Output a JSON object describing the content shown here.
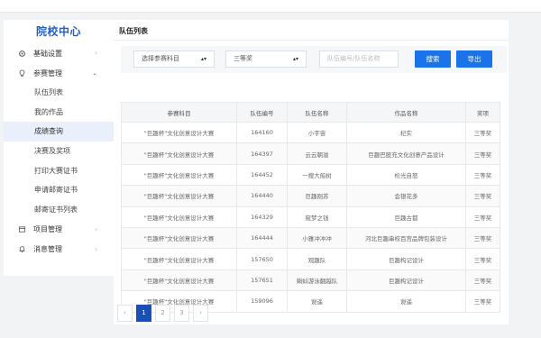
{
  "sidebar": {
    "brand": "院校中心",
    "menus": [
      {
        "label": "基础设置",
        "icon": "settings-icon"
      },
      {
        "label": "参赛管理",
        "icon": "lightbulb-icon"
      },
      {
        "label": "项目管理",
        "icon": "project-icon"
      },
      {
        "label": "消息管理",
        "icon": "bell-icon"
      }
    ],
    "sub_items": [
      "队伍列表",
      "我的作品",
      "成绩查询",
      "决赛及奖项",
      "打印大赛证书",
      "申请邮寄证书",
      "邮寄证书列表"
    ],
    "active_sub_item": "成绩查询"
  },
  "main": {
    "title": "队伍列表"
  },
  "filters": {
    "subject_select": "选择参赛科目",
    "award_select": "三等奖",
    "search_placeholder": "队伍编号/队伍名称",
    "search_button": "搜索",
    "export_button": "导出"
  },
  "table": {
    "headers": [
      "参赛科目",
      "队伍编号",
      "队伍名称",
      "作品名称",
      "奖项"
    ],
    "rows": [
      [
        "\"巨趣杯\"文化创意设计大赛",
        "164160",
        "小宇宙",
        "杞实",
        "三等奖"
      ],
      [
        "\"巨趣杯\"文化创意设计大赛",
        "164397",
        "云云朝滋",
        "巨趣巴股充文化创意产品设计",
        "三等奖"
      ],
      [
        "\"巨趣杯\"文化创意设计大赛",
        "164452",
        "一搜大船树",
        "检光自怒",
        "三等奖"
      ],
      [
        "\"巨趣杯\"文化创意设计大赛",
        "164440",
        "巨趣刚苏",
        "会银花多",
        "三等奖"
      ],
      [
        "\"巨趣杯\"文化创意设计大赛",
        "164329",
        "窥梦之钱",
        "巨趣古都",
        "三等奖"
      ],
      [
        "\"巨趣杯\"文化创意设计大赛",
        "164444",
        "小雅冲冲冲",
        "河北巨趣串校百宫品牌包装设计",
        "三等奖"
      ],
      [
        "\"巨趣杯\"文化创意设计大赛",
        "157650",
        "观趣队",
        "巨趣构记设计",
        "三等奖"
      ],
      [
        "\"巨趣杯\"文化创意设计大赛",
        "157651",
        "蝌蚪游泳翻越队",
        "巨趣构记设计",
        "三等奖"
      ],
      [
        "\"巨趣杯\"文化创意设计大赛",
        "159096",
        "谠遥",
        "谠遥",
        "三等奖"
      ]
    ]
  },
  "pagination": {
    "prev": "‹",
    "pages": [
      "1",
      "2",
      "3"
    ],
    "current": "1",
    "next": "›"
  }
}
